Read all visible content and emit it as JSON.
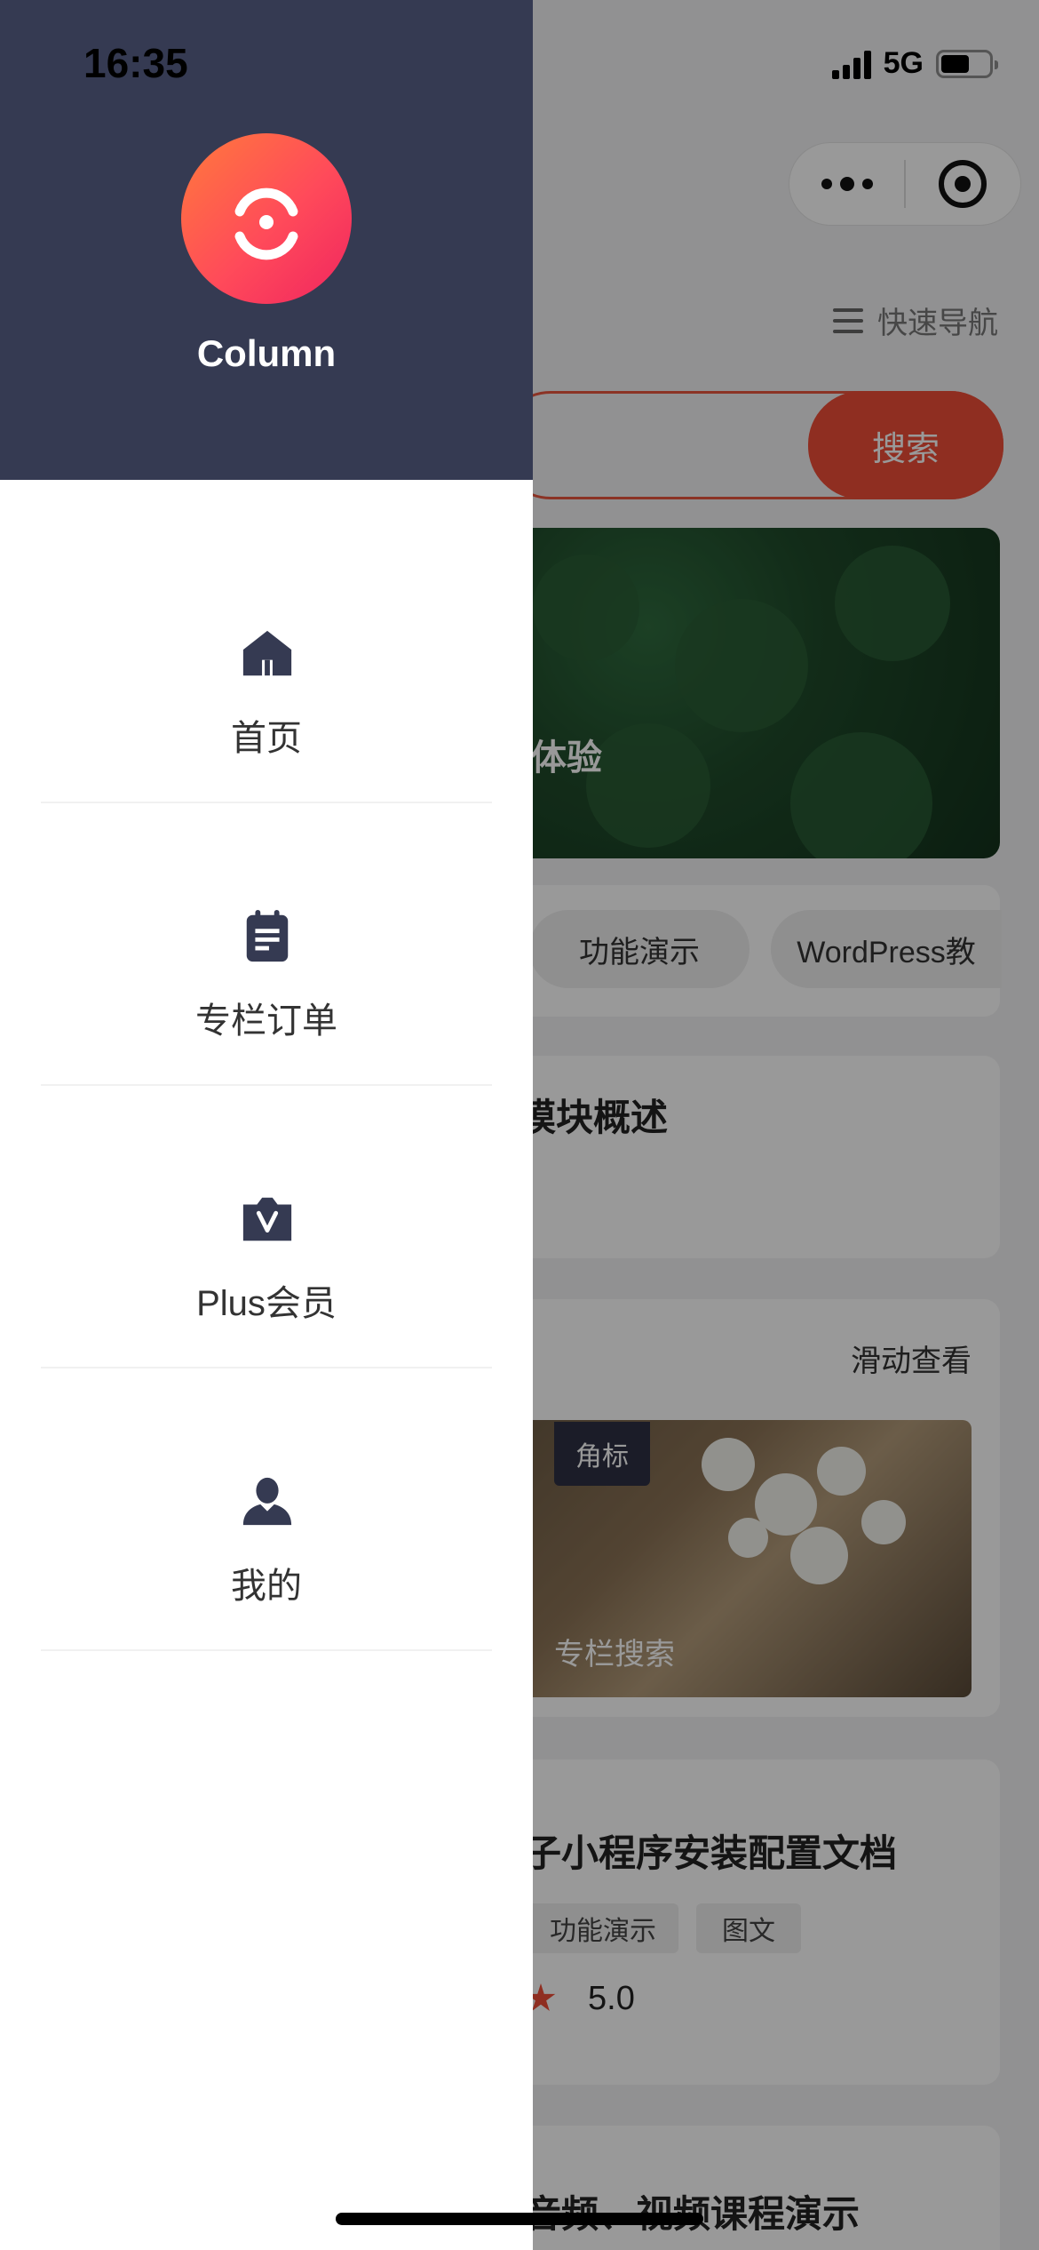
{
  "status_bar": {
    "time": "16:35",
    "network": "5G"
  },
  "drawer": {
    "brand": "Column",
    "items": [
      {
        "label": "首页",
        "icon": "home-icon"
      },
      {
        "label": "专栏订单",
        "icon": "clipboard-icon"
      },
      {
        "label": "Plus会员",
        "icon": "vip-bag-icon"
      },
      {
        "label": "我的",
        "icon": "user-icon"
      }
    ]
  },
  "background": {
    "quick_nav_label": "快速导航",
    "search_button": "搜索",
    "banner_text": "体验",
    "chips": [
      "功能演示",
      "WordPress教"
    ],
    "module_title": "模块概述",
    "swipe_label": "滑动查看",
    "corner_badge": "角标",
    "card_caption": "专栏搜索",
    "doc_title": "子小程序安装配置文档",
    "tags": [
      "功能演示",
      "图文"
    ],
    "rating": "5.0",
    "last_title": "音频、视频课程演示"
  },
  "colors": {
    "drawer_header": "#353a52",
    "accent": "#ef4e37",
    "logo_gradient_start": "#ff7a3c",
    "logo_gradient_end": "#f0255f"
  }
}
